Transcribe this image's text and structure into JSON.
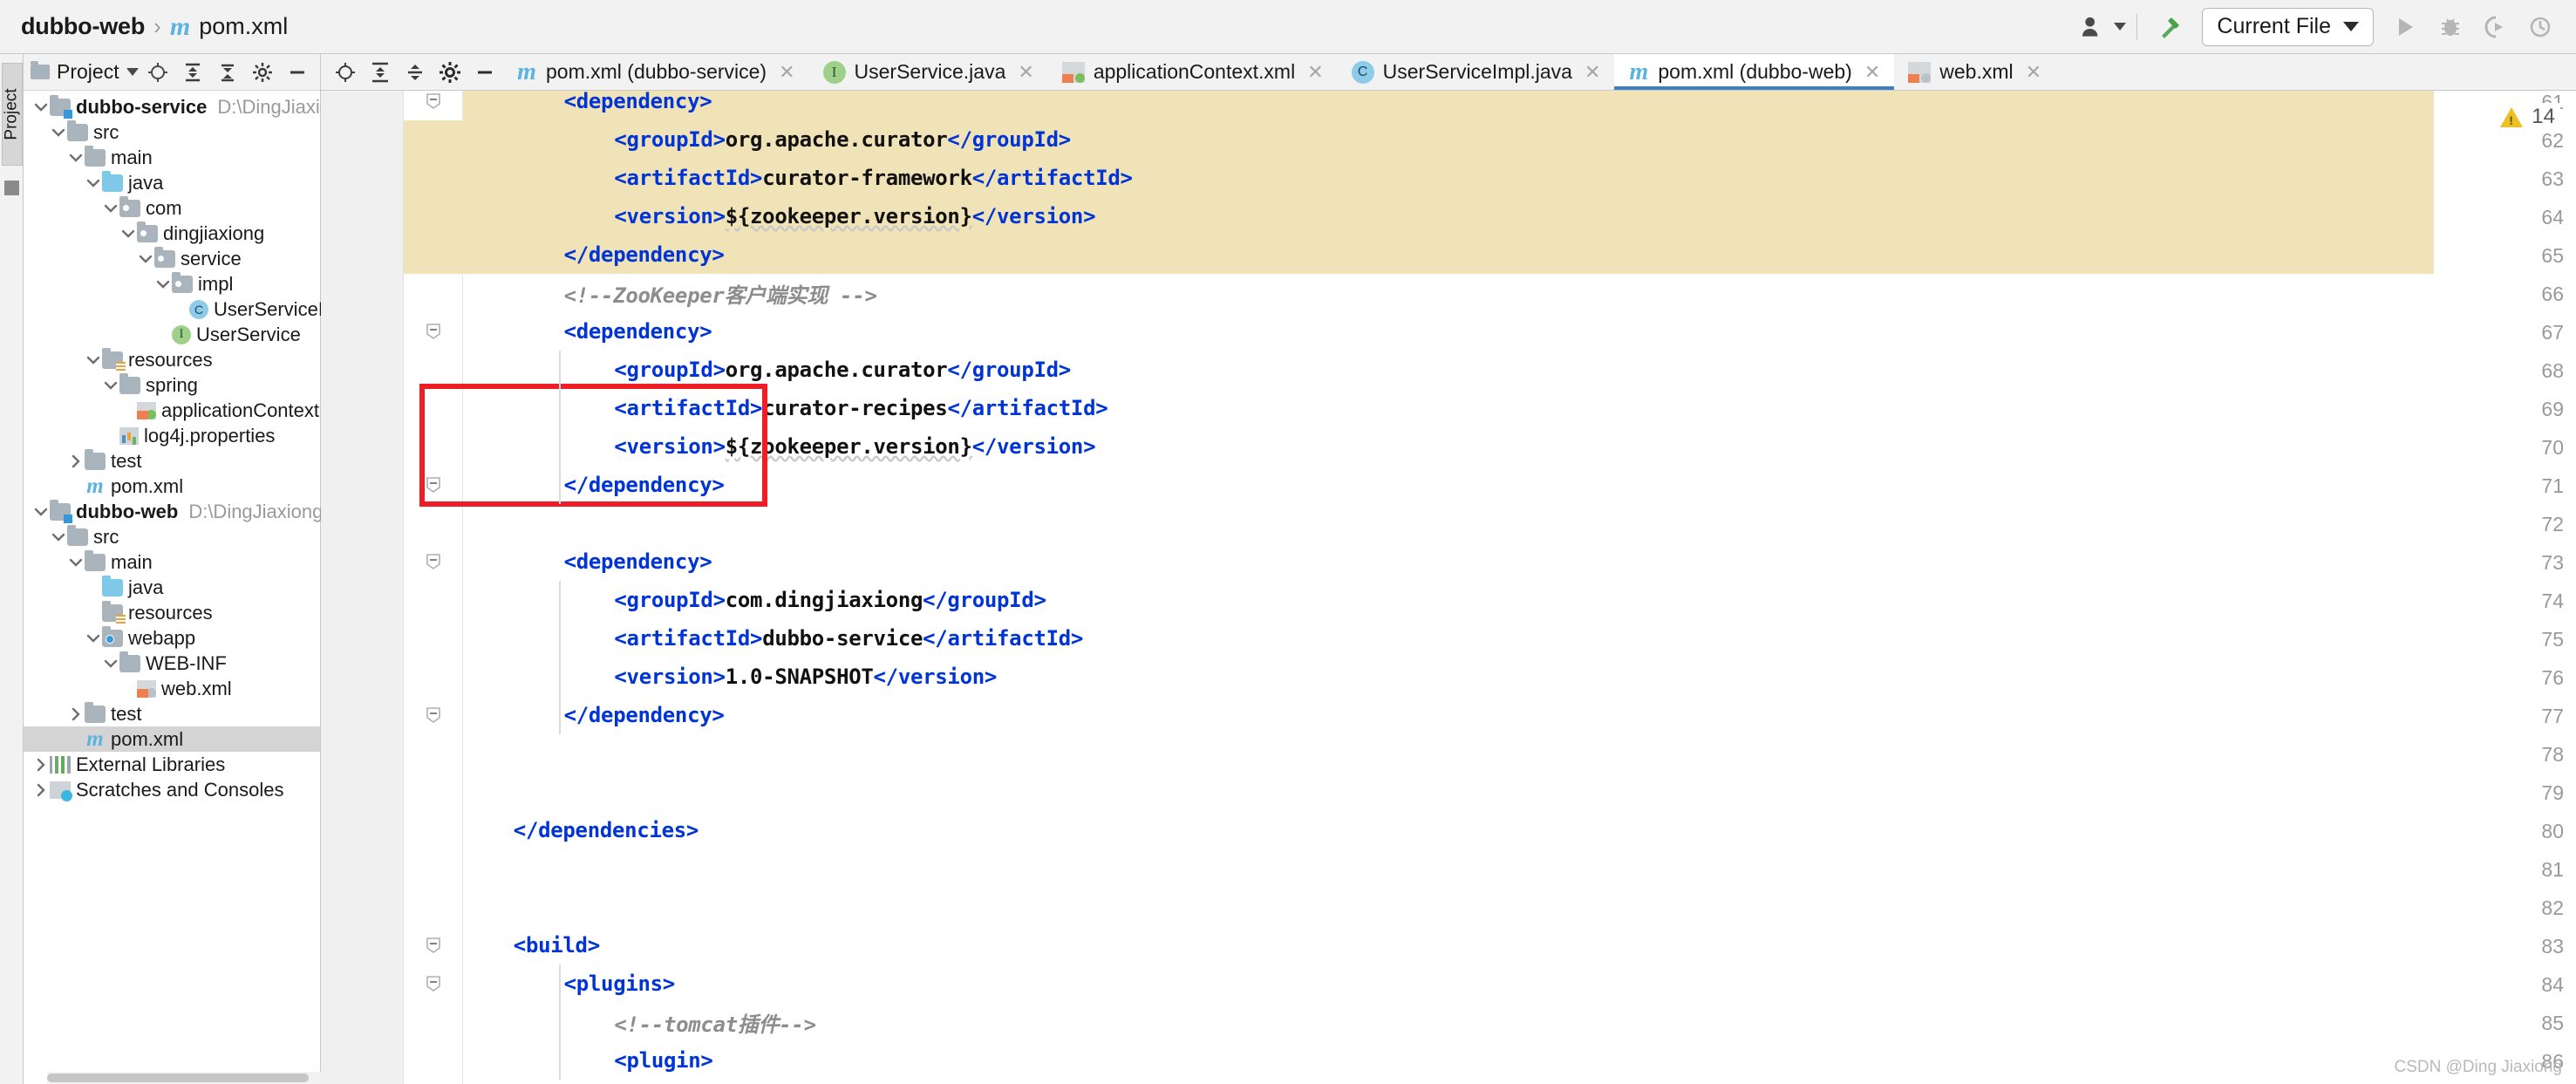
{
  "navbar": {
    "breadcrumb": {
      "project": "dubbo-web",
      "separator": "›",
      "file": "pom.xml",
      "maven_icon": "m"
    },
    "run_config": {
      "label": "Current File"
    },
    "icons": [
      "user-avatar-icon",
      "build-hammer-icon",
      "run-icon",
      "debug-icon",
      "coverage-icon",
      "profile-icon"
    ]
  },
  "left_strip": {
    "project_tab": "Project"
  },
  "project_panel": {
    "header": {
      "title": "Project",
      "icons": [
        "folder-icon",
        "chevron-down-icon",
        "locate-icon",
        "collapse-all-icon",
        "expand-icon",
        "settings-gear-icon",
        "hide-icon"
      ]
    },
    "tree": [
      {
        "indent": 0,
        "arrow": "down",
        "icon": "module-folder",
        "label": "dubbo-service",
        "bold": true,
        "path": "D:\\DingJiaxiong\\IdeaProjects\\dub",
        "selected": false
      },
      {
        "indent": 1,
        "arrow": "down",
        "icon": "folder",
        "label": "src",
        "bold": false,
        "path": "",
        "selected": false
      },
      {
        "indent": 2,
        "arrow": "down",
        "icon": "folder",
        "label": "main",
        "bold": false,
        "path": "",
        "selected": false
      },
      {
        "indent": 3,
        "arrow": "down",
        "icon": "folder-source",
        "label": "java",
        "bold": false,
        "path": "",
        "selected": false
      },
      {
        "indent": 4,
        "arrow": "down",
        "icon": "folder-pkg",
        "label": "com",
        "bold": false,
        "path": "",
        "selected": false
      },
      {
        "indent": 5,
        "arrow": "down",
        "icon": "folder-pkg",
        "label": "dingjiaxiong",
        "bold": false,
        "path": "",
        "selected": false
      },
      {
        "indent": 6,
        "arrow": "down",
        "icon": "folder-pkg",
        "label": "service",
        "bold": false,
        "path": "",
        "selected": false
      },
      {
        "indent": 7,
        "arrow": "down",
        "icon": "folder-pkg",
        "label": "impl",
        "bold": false,
        "path": "",
        "selected": false
      },
      {
        "indent": 8,
        "arrow": "none",
        "icon": "java-class",
        "label": "UserServiceImpl",
        "bold": false,
        "path": "",
        "selected": false
      },
      {
        "indent": 7,
        "arrow": "none",
        "icon": "java-interface",
        "label": "UserService",
        "bold": false,
        "path": "",
        "selected": false
      },
      {
        "indent": 3,
        "arrow": "down",
        "icon": "folder-resource",
        "label": "resources",
        "bold": false,
        "path": "",
        "selected": false
      },
      {
        "indent": 4,
        "arrow": "down",
        "icon": "folder",
        "label": "spring",
        "bold": false,
        "path": "",
        "selected": false
      },
      {
        "indent": 5,
        "arrow": "none",
        "icon": "xml-spring",
        "label": "applicationContext.xml",
        "bold": false,
        "path": "",
        "selected": false
      },
      {
        "indent": 4,
        "arrow": "none",
        "icon": "properties",
        "label": "log4j.properties",
        "bold": false,
        "path": "",
        "selected": false
      },
      {
        "indent": 2,
        "arrow": "right",
        "icon": "folder",
        "label": "test",
        "bold": false,
        "path": "",
        "selected": false
      },
      {
        "indent": 2,
        "arrow": "none",
        "icon": "maven",
        "label": "pom.xml",
        "bold": false,
        "path": "",
        "selected": false
      },
      {
        "indent": 0,
        "arrow": "down",
        "icon": "module-folder",
        "label": "dubbo-web",
        "bold": true,
        "path": "D:\\DingJiaxiong\\IdeaProjects\\dubbo",
        "selected": false
      },
      {
        "indent": 1,
        "arrow": "down",
        "icon": "folder",
        "label": "src",
        "bold": false,
        "path": "",
        "selected": false
      },
      {
        "indent": 2,
        "arrow": "down",
        "icon": "folder",
        "label": "main",
        "bold": false,
        "path": "",
        "selected": false
      },
      {
        "indent": 3,
        "arrow": "none",
        "icon": "folder-source",
        "label": "java",
        "bold": false,
        "path": "",
        "selected": false
      },
      {
        "indent": 3,
        "arrow": "none",
        "icon": "folder-resource",
        "label": "resources",
        "bold": false,
        "path": "",
        "selected": false
      },
      {
        "indent": 3,
        "arrow": "down",
        "icon": "folder-web",
        "label": "webapp",
        "bold": false,
        "path": "",
        "selected": false
      },
      {
        "indent": 4,
        "arrow": "down",
        "icon": "folder",
        "label": "WEB-INF",
        "bold": false,
        "path": "",
        "selected": false
      },
      {
        "indent": 5,
        "arrow": "none",
        "icon": "xml-web",
        "label": "web.xml",
        "bold": false,
        "path": "",
        "selected": false
      },
      {
        "indent": 2,
        "arrow": "right",
        "icon": "folder",
        "label": "test",
        "bold": false,
        "path": "",
        "selected": false
      },
      {
        "indent": 2,
        "arrow": "none",
        "icon": "maven",
        "label": "pom.xml",
        "bold": false,
        "path": "",
        "selected": true
      },
      {
        "indent": 0,
        "arrow": "right",
        "icon": "libraries",
        "label": "External Libraries",
        "bold": false,
        "path": "",
        "selected": false
      },
      {
        "indent": 0,
        "arrow": "right",
        "icon": "scratches",
        "label": "Scratches and Consoles",
        "bold": false,
        "path": "",
        "selected": false
      }
    ]
  },
  "editor_tabs": [
    {
      "label": "pom.xml (dubbo-service)",
      "icon": "maven-icon",
      "active": false
    },
    {
      "label": "UserService.java",
      "icon": "java-interface-icon",
      "active": false
    },
    {
      "label": "applicationContext.xml",
      "icon": "spring-xml-icon",
      "active": false
    },
    {
      "label": "UserServiceImpl.java",
      "icon": "java-class-icon",
      "active": false
    },
    {
      "label": "pom.xml (dubbo-web)",
      "icon": "maven-icon",
      "active": true
    },
    {
      "label": "web.xml",
      "icon": "web-xml-icon",
      "active": false
    }
  ],
  "editor": {
    "warning_badge": {
      "count": "14",
      "icon": "warning-triangle-icon"
    },
    "watermark": "CSDN @Ding Jiaxiong",
    "line_numbers": [
      "61",
      "62",
      "63",
      "64",
      "65",
      "66",
      "67",
      "68",
      "69",
      "70",
      "71",
      "72",
      "73",
      "74",
      "75",
      "76",
      "77",
      "78",
      "79",
      "80",
      "81",
      "82",
      "83",
      "84",
      "85",
      "86"
    ],
    "lines": [
      {
        "num": "61",
        "indent": 2,
        "segments": [
          {
            "t": "tag",
            "v": "<dependency>"
          }
        ],
        "highlight": true
      },
      {
        "num": "62",
        "indent": 3,
        "segments": [
          {
            "t": "tag",
            "v": "<groupId>"
          },
          {
            "t": "txt",
            "v": "org.apache.curator"
          },
          {
            "t": "tag",
            "v": "</groupId>"
          }
        ],
        "highlight": true
      },
      {
        "num": "63",
        "indent": 3,
        "segments": [
          {
            "t": "tag",
            "v": "<artifactId>"
          },
          {
            "t": "txt",
            "v": "curator-framework"
          },
          {
            "t": "tag",
            "v": "</artifactId>"
          }
        ],
        "highlight": true
      },
      {
        "num": "64",
        "indent": 3,
        "segments": [
          {
            "t": "tag",
            "v": "<version>"
          },
          {
            "t": "txt",
            "v": "${zookeeper.version}"
          },
          {
            "t": "tag",
            "v": "</version>"
          }
        ],
        "highlight": true
      },
      {
        "num": "65",
        "indent": 2,
        "segments": [
          {
            "t": "tag",
            "v": "</dependency>"
          }
        ],
        "highlight": true
      },
      {
        "num": "66",
        "indent": 2,
        "segments": [
          {
            "t": "cmt",
            "v": "<!--ZooKeeper客户端实现 -->"
          }
        ],
        "highlight": false
      },
      {
        "num": "67",
        "indent": 2,
        "segments": [
          {
            "t": "tag",
            "v": "<dependency>"
          }
        ],
        "highlight": false
      },
      {
        "num": "68",
        "indent": 3,
        "segments": [
          {
            "t": "tag",
            "v": "<groupId>"
          },
          {
            "t": "txt",
            "v": "org.apache.curator"
          },
          {
            "t": "tag",
            "v": "</groupId>"
          }
        ],
        "highlight": false
      },
      {
        "num": "69",
        "indent": 3,
        "segments": [
          {
            "t": "tag",
            "v": "<artifactId>"
          },
          {
            "t": "txt",
            "v": "curator-recipes"
          },
          {
            "t": "tag",
            "v": "</artifactId>"
          }
        ],
        "highlight": false
      },
      {
        "num": "70",
        "indent": 3,
        "segments": [
          {
            "t": "tag",
            "v": "<version>"
          },
          {
            "t": "txt",
            "v": "${zookeeper.version}"
          },
          {
            "t": "tag",
            "v": "</version>"
          }
        ],
        "highlight": false
      },
      {
        "num": "71",
        "indent": 2,
        "segments": [
          {
            "t": "tag",
            "v": "</dependency>"
          }
        ],
        "highlight": false
      },
      {
        "num": "72",
        "indent": 0,
        "segments": [],
        "highlight": false
      },
      {
        "num": "73",
        "indent": 2,
        "segments": [
          {
            "t": "tag",
            "v": "<dependency>"
          }
        ],
        "highlight": false
      },
      {
        "num": "74",
        "indent": 3,
        "segments": [
          {
            "t": "tag",
            "v": "<groupId>"
          },
          {
            "t": "txt",
            "v": "com.dingjiaxiong"
          },
          {
            "t": "tag",
            "v": "</groupId>"
          }
        ],
        "highlight": false
      },
      {
        "num": "75",
        "indent": 3,
        "segments": [
          {
            "t": "tag",
            "v": "<artifactId>"
          },
          {
            "t": "txt",
            "v": "dubbo-service"
          },
          {
            "t": "tag",
            "v": "</artifactId>"
          }
        ],
        "highlight": false
      },
      {
        "num": "76",
        "indent": 3,
        "segments": [
          {
            "t": "tag",
            "v": "<version>"
          },
          {
            "t": "txt",
            "v": "1.0-SNAPSHOT"
          },
          {
            "t": "tag",
            "v": "</version>"
          }
        ],
        "highlight": false
      },
      {
        "num": "77",
        "indent": 2,
        "segments": [
          {
            "t": "tag",
            "v": "</dependency>"
          }
        ],
        "highlight": false
      },
      {
        "num": "78",
        "indent": 0,
        "segments": [],
        "highlight": false
      },
      {
        "num": "79",
        "indent": 0,
        "segments": [],
        "highlight": false
      },
      {
        "num": "80",
        "indent": 1,
        "segments": [
          {
            "t": "tag",
            "v": "</dependencies>"
          }
        ],
        "highlight": false
      },
      {
        "num": "81",
        "indent": 0,
        "segments": [],
        "highlight": false
      },
      {
        "num": "82",
        "indent": 0,
        "segments": [],
        "highlight": false
      },
      {
        "num": "83",
        "indent": 1,
        "segments": [
          {
            "t": "tag",
            "v": "<build>"
          }
        ],
        "highlight": false
      },
      {
        "num": "84",
        "indent": 2,
        "segments": [
          {
            "t": "tag",
            "v": "<plugins>"
          }
        ],
        "highlight": false
      },
      {
        "num": "85",
        "indent": 3,
        "segments": [
          {
            "t": "cmt",
            "v": "<!--tomcat插件-->"
          }
        ],
        "highlight": false
      },
      {
        "num": "86",
        "indent": 3,
        "segments": [
          {
            "t": "tag",
            "v": "<plugin>"
          }
        ],
        "highlight": false
      }
    ]
  },
  "colors": {
    "tag_blue": "#0034d4",
    "text_black": "#111111",
    "comment_grey": "#8d8d8d",
    "highlight_yellow": "#f1e3b8",
    "annotation_red": "#ee1d26",
    "active_tab_underline": "#3e7fbf",
    "maven_icon_blue": "#59b4e0"
  }
}
